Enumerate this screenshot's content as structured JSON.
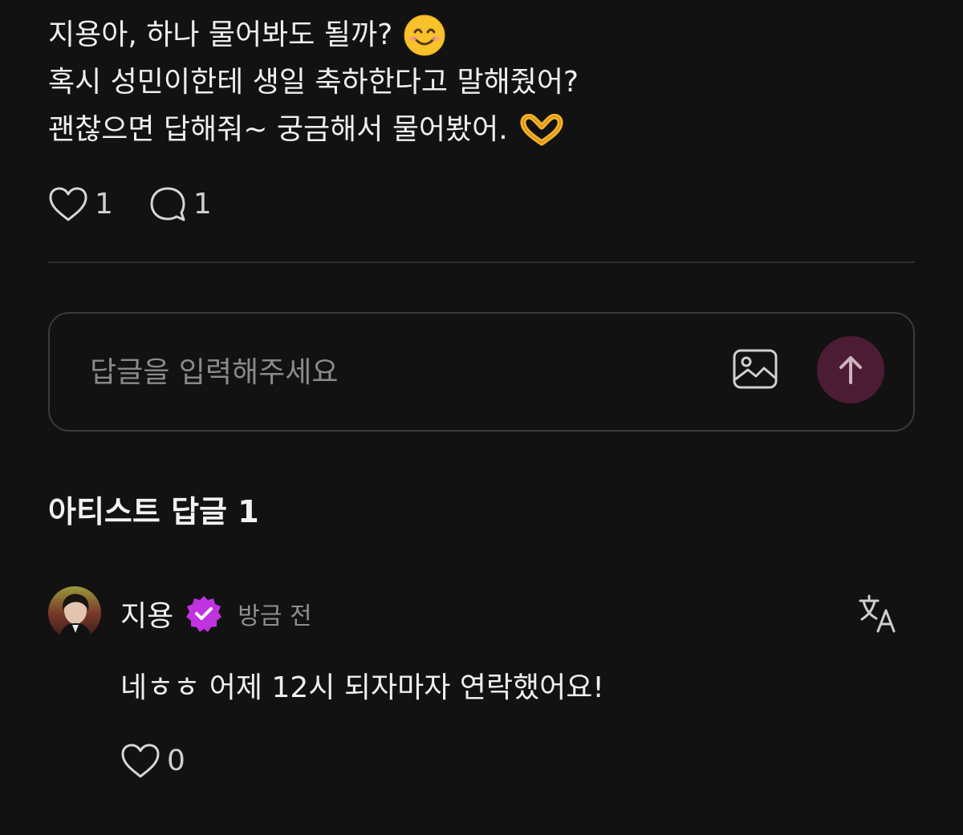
{
  "post": {
    "lines": [
      "지용아, 하나 물어봐도 될까?",
      "혹시 성민이한테 생일 축하한다고 말해줬어?",
      "괜찮으면 답해줘~ 궁금해서 물어봤어."
    ],
    "emojis": [
      "smiling-face-emoji",
      "heart-hands-emoji"
    ],
    "like_count": "1",
    "comment_count": "1"
  },
  "reply": {
    "placeholder": "답글을 입력해주세요"
  },
  "section": {
    "title": "아티스트 답글 1"
  },
  "comment": {
    "author": "지용",
    "time": "방금 전",
    "text": "네ㅎㅎ 어제 12시 되자마자 연락했어요!",
    "like_count": "0"
  },
  "colors": {
    "background": "#121212",
    "send_button": "#4c1c34",
    "verified_badge": "#c133e0"
  }
}
